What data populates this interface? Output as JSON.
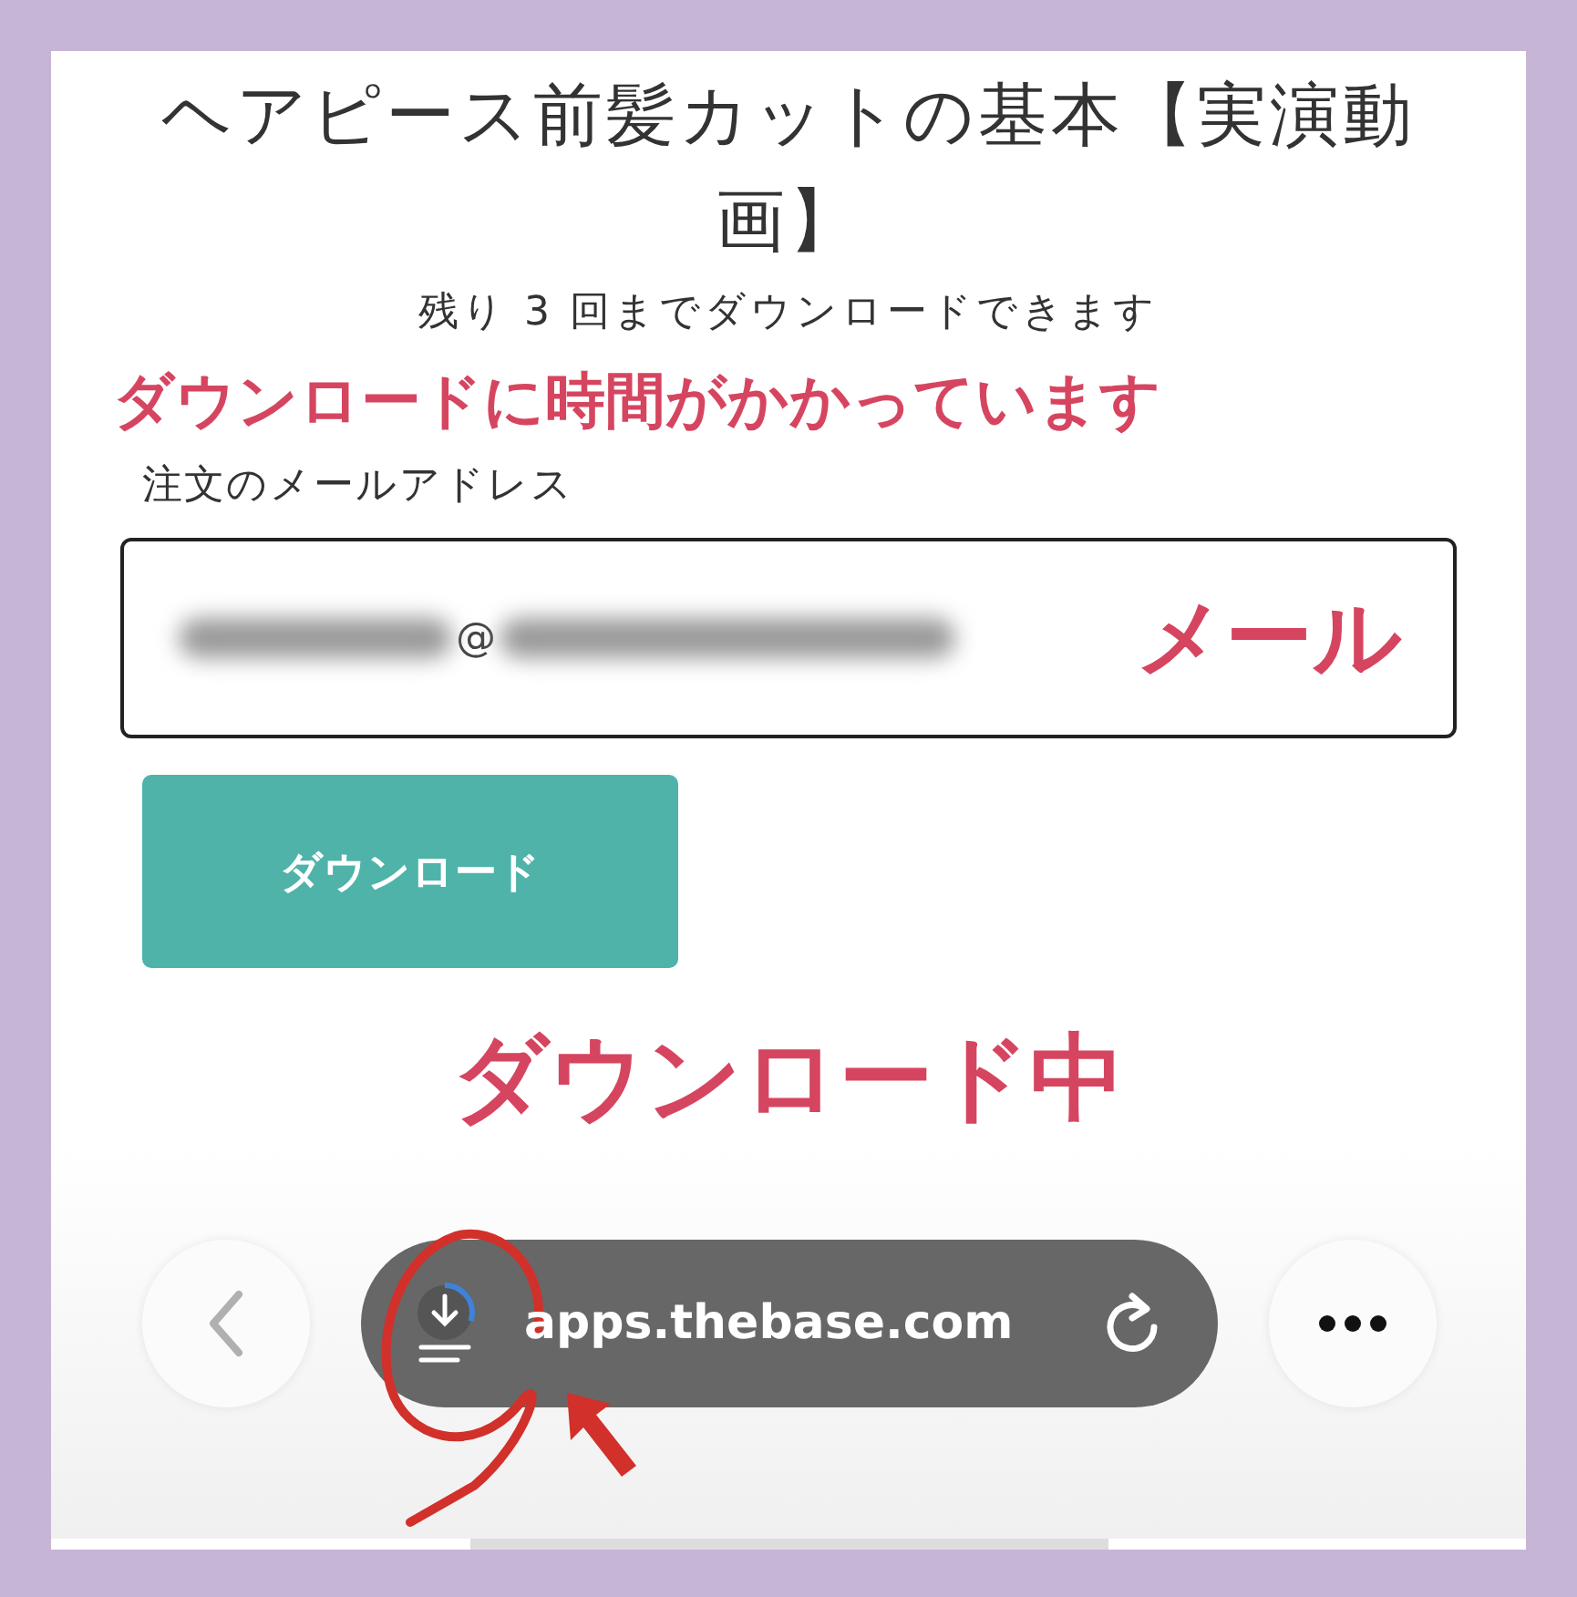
{
  "product_title": "ヘアピース前髪カットの基本【実演動画】",
  "remaining_note": "残り 3 回までダウンロードできます",
  "annotation_top": "ダウンロードに時間がかかっています",
  "email_label": "注文のメールアドレス",
  "email_field": {
    "value": "@"
  },
  "annotation_field": "メール",
  "download_button": "ダウンロード",
  "annotation_bottom": "ダウンロード中",
  "browser_bar": {
    "url": "apps.thebase.com",
    "download_progress": {
      "level": 0.3
    }
  }
}
